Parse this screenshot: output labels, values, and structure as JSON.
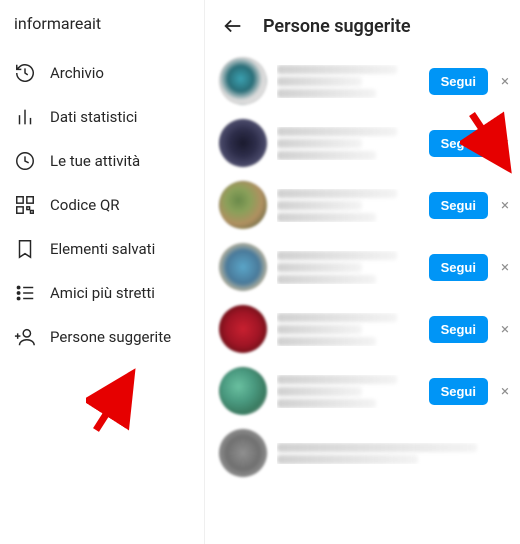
{
  "sidebar": {
    "username": "informareait",
    "items": [
      {
        "label": "Archivio"
      },
      {
        "label": "Dati statistici"
      },
      {
        "label": "Le tue attività"
      },
      {
        "label": "Codice QR"
      },
      {
        "label": "Elementi salvati"
      },
      {
        "label": "Amici più stretti"
      },
      {
        "label": "Persone suggerite"
      }
    ]
  },
  "header": {
    "title": "Persone suggerite"
  },
  "suggestions": {
    "follow_label": "Segui",
    "rows": [
      {},
      {},
      {},
      {},
      {},
      {},
      {}
    ]
  },
  "colors": {
    "accent": "#0095f6",
    "arrow": "#e60000"
  }
}
